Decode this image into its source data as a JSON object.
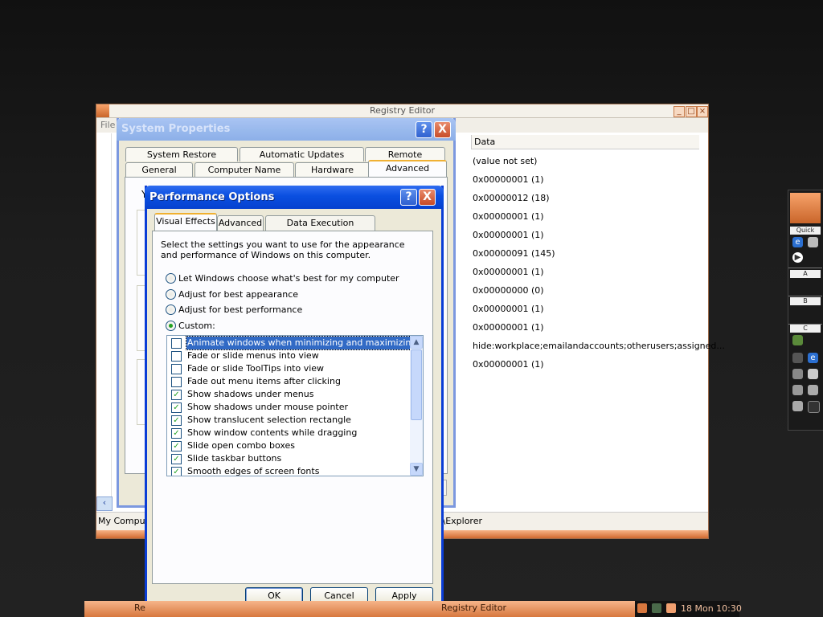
{
  "registry_editor": {
    "title": "Registry Editor",
    "menu_first": "File",
    "column_data_header": "Data",
    "data_values": [
      "(value not set)",
      "0x00000001 (1)",
      "0x00000012 (18)",
      "0x00000001 (1)",
      "0x00000001 (1)",
      "0x00000091 (145)",
      "0x00000001 (1)",
      "0x00000000 (0)",
      "0x00000001 (1)",
      "0x00000001 (1)",
      "hide:workplace;emailandaccounts;otherusers;assigned...",
      "0x00000001 (1)"
    ],
    "status_left": "My Compute",
    "status_right": "es\\Explorer"
  },
  "system_properties": {
    "title": "System Properties",
    "tabs_row1": [
      "System Restore",
      "Automatic Updates",
      "Remote"
    ],
    "tabs_row2": [
      "General",
      "Computer Name",
      "Hardware",
      "Advanced"
    ],
    "active_tab": "Advanced",
    "fragment_char": "Y"
  },
  "performance_options": {
    "title": "Performance Options",
    "tabs": [
      "Visual Effects",
      "Advanced",
      "Data Execution Prevention"
    ],
    "active_tab": "Visual Effects",
    "description": "Select the settings you want to use for the appearance and performance of Windows on this computer.",
    "radios": [
      {
        "label": "Let Windows choose what's best for my computer",
        "checked": false
      },
      {
        "label": "Adjust for best appearance",
        "checked": false
      },
      {
        "label": "Adjust for best performance",
        "checked": false
      },
      {
        "label": "Custom:",
        "checked": true
      }
    ],
    "effects": [
      {
        "label": "Animate windows when minimizing and maximizing",
        "checked": false,
        "selected": true
      },
      {
        "label": "Fade or slide menus into view",
        "checked": false,
        "selected": false
      },
      {
        "label": "Fade or slide ToolTips into view",
        "checked": false,
        "selected": false
      },
      {
        "label": "Fade out menu items after clicking",
        "checked": false,
        "selected": false
      },
      {
        "label": "Show shadows under menus",
        "checked": true,
        "selected": false
      },
      {
        "label": "Show shadows under mouse pointer",
        "checked": true,
        "selected": false
      },
      {
        "label": "Show translucent selection rectangle",
        "checked": true,
        "selected": false
      },
      {
        "label": "Show window contents while dragging",
        "checked": true,
        "selected": false
      },
      {
        "label": "Slide open combo boxes",
        "checked": true,
        "selected": false
      },
      {
        "label": "Slide taskbar buttons",
        "checked": true,
        "selected": false
      },
      {
        "label": "Smooth edges of screen fonts",
        "checked": true,
        "selected": false
      }
    ],
    "buttons": {
      "ok": "OK",
      "cancel": "Cancel",
      "apply": "Apply"
    },
    "help_glyph": "?",
    "close_glyph": "X"
  },
  "dock": {
    "label_quick": "Quick",
    "label_a": "A",
    "label_b": "B",
    "label_c": "C"
  },
  "taskbar": {
    "left_text": "Re",
    "middle_text": "Registry Editor",
    "clock": "18 Mon 10:30"
  },
  "colors": {
    "xp_title_blue": "#0a4fe0",
    "accent_orange": "#d7773e",
    "check_green": "#21a121",
    "selection_blue": "#316ac5"
  }
}
